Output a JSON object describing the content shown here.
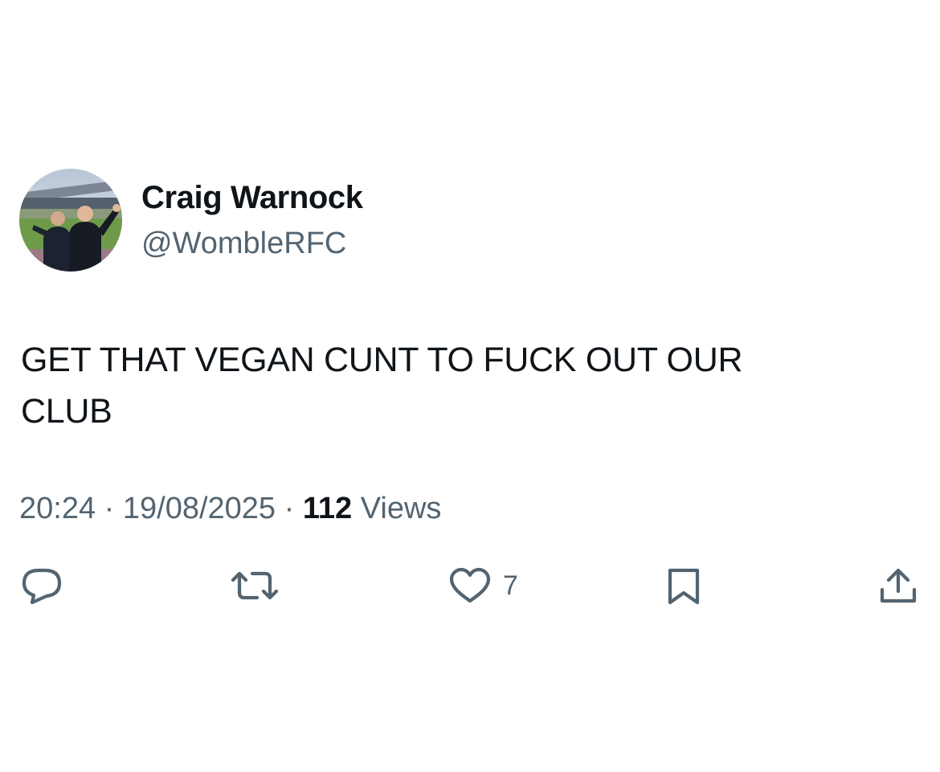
{
  "author": {
    "display_name": "Craig Warnock",
    "handle": "@WombleRFC",
    "avatar_icon": "profile-photo-stadium"
  },
  "tweet": {
    "text_line1": "GET THAT VEGAN CUNT TO FUCK OUT OUR",
    "text_line2": "CLUB"
  },
  "meta": {
    "time": "20:24",
    "separator": "·",
    "date": "19/08/2025",
    "views_count": "112",
    "views_label": "Views"
  },
  "actions": {
    "reply_icon": "reply-icon",
    "retweet_icon": "retweet-icon",
    "like_icon": "heart-icon",
    "like_count": "7",
    "bookmark_icon": "bookmark-icon",
    "share_icon": "share-icon"
  },
  "colors": {
    "text_primary": "#0f1419",
    "text_secondary": "#536471",
    "background": "#ffffff"
  }
}
